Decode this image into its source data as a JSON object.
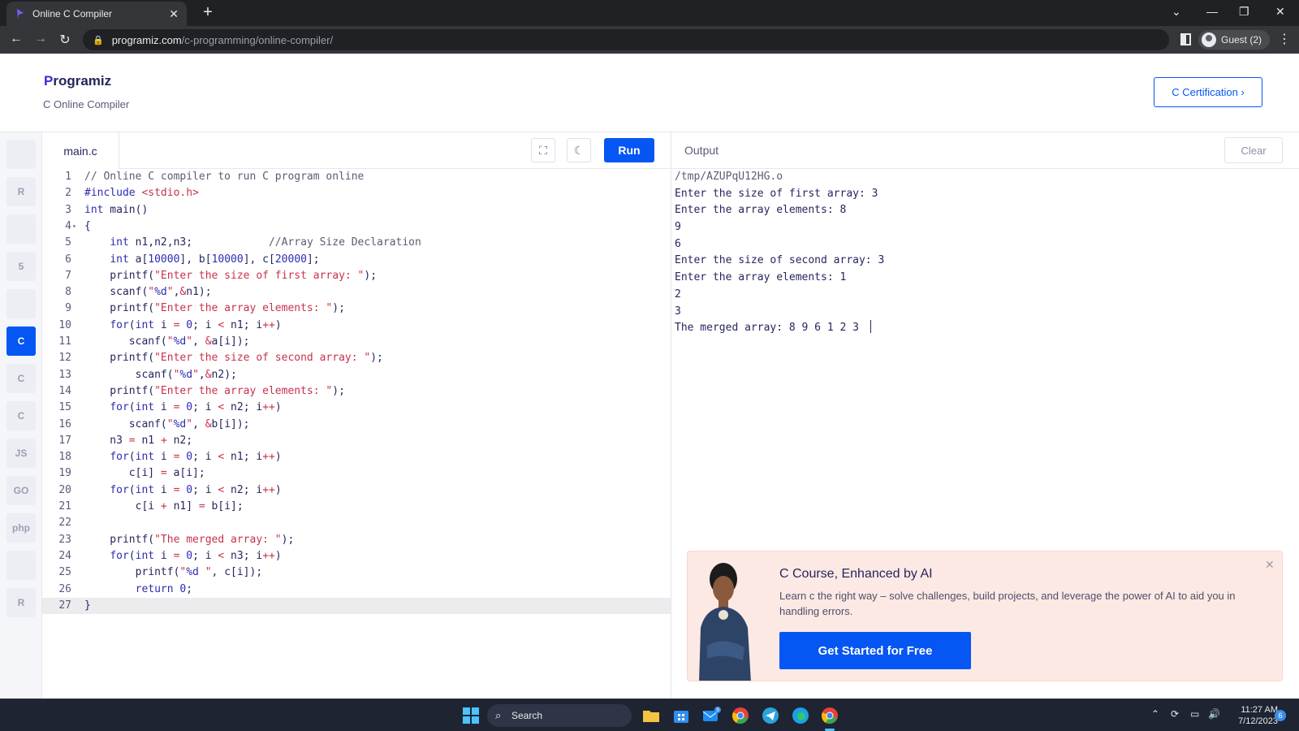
{
  "browser": {
    "tab_title": "Online C Compiler",
    "url_host": "programiz.com",
    "url_path": "/c-programming/online-compiler/",
    "profile_label": "Guest (2)"
  },
  "header": {
    "logo": "Programiz",
    "subtitle": "C Online Compiler",
    "cert_button": "C Certification ›"
  },
  "sidebar": {
    "languages": [
      {
        "name": "python-icon",
        "label": ""
      },
      {
        "name": "r-icon",
        "label": "R"
      },
      {
        "name": "sql-icon",
        "label": ""
      },
      {
        "name": "html-icon",
        "label": "5"
      },
      {
        "name": "java-icon",
        "label": ""
      },
      {
        "name": "c-icon",
        "label": "C"
      },
      {
        "name": "cpp-icon",
        "label": "C"
      },
      {
        "name": "csharp-icon",
        "label": "C"
      },
      {
        "name": "js-icon",
        "label": "JS"
      },
      {
        "name": "go-icon",
        "label": "GO"
      },
      {
        "name": "php-icon",
        "label": "php"
      },
      {
        "name": "swift-icon",
        "label": ""
      },
      {
        "name": "rust-icon",
        "label": "R"
      }
    ]
  },
  "editor": {
    "file_name": "main.c",
    "run_label": "Run",
    "current_line": 27,
    "lines": [
      "// Online C compiler to run C program online",
      "#include <stdio.h>",
      "int main()",
      "{",
      "    int n1,n2,n3;            //Array Size Declaration",
      "    int a[10000], b[10000], c[20000];",
      "    printf(\"Enter the size of first array: \");",
      "    scanf(\"%d\",&n1);",
      "    printf(\"Enter the array elements: \");",
      "    for(int i = 0; i < n1; i++)",
      "       scanf(\"%d\", &a[i]);",
      "    printf(\"Enter the size of second array: \");",
      "        scanf(\"%d\",&n2);",
      "    printf(\"Enter the array elements: \");",
      "    for(int i = 0; i < n2; i++)",
      "       scanf(\"%d\", &b[i]);",
      "    n3 = n1 + n2;",
      "    for(int i = 0; i < n1; i++)",
      "       c[i] = a[i];",
      "    for(int i = 0; i < n2; i++)",
      "        c[i + n1] = b[i];",
      "",
      "    printf(\"The merged array: \");",
      "    for(int i = 0; i < n3; i++)",
      "        printf(\"%d \", c[i]);",
      "        return 0;",
      "}"
    ]
  },
  "output": {
    "title": "Output",
    "clear_label": "Clear",
    "lines": [
      "/tmp/AZUPqU12HG.o",
      "Enter the size of first array: 3",
      "Enter the array elements: 8",
      "9",
      "6",
      "Enter the size of second array: 3",
      "Enter the array elements: 1",
      "2",
      "3",
      "The merged array: 8 9 6 1 2 3 "
    ]
  },
  "promo": {
    "title": "C Course, Enhanced by AI",
    "text": "Learn c the right way – solve challenges, build projects, and leverage the power of AI to aid you in handling errors.",
    "button": "Get Started for Free"
  },
  "taskbar": {
    "search_label": "Search",
    "time": "11:27 AM",
    "date": "7/12/2023",
    "notification_count": "6",
    "mail_badge": "9"
  },
  "colors": {
    "accent": "#0556f3",
    "active_tab_bg": "#0556f3",
    "promo_bg": "#fde9e4"
  }
}
